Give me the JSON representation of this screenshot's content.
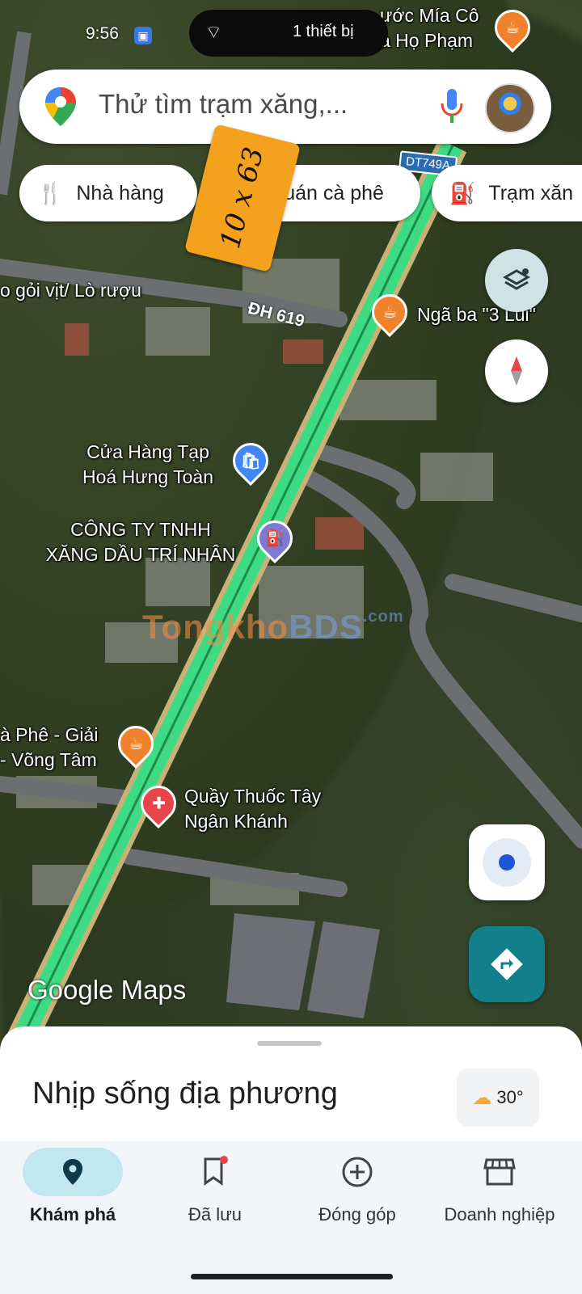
{
  "status_bar": {
    "time": "9:56",
    "island_text": "1 thiết bị"
  },
  "search": {
    "placeholder": "Thử tìm trạm xăng,..."
  },
  "chips": [
    {
      "label": "Nhà hàng",
      "icon": "fork-knife-icon"
    },
    {
      "label": "quán cà phê",
      "icon": "coffee-icon"
    },
    {
      "label": "Trạm xăn",
      "icon": "gas-pump-icon"
    }
  ],
  "sticker": {
    "text": "10 x 63"
  },
  "map": {
    "route_shield": "DT749A",
    "road_label": "ĐH 619",
    "places": {
      "top_partial": {
        "line1": "ước Mía Cô",
        "line2": "a Họ Phạm"
      },
      "lo_ruou": "o gỏi vịt/ Lò rượu",
      "nga_ba": "Ngã ba \"3 Lũi\"",
      "cua_hang": {
        "line1": "Cửa Hàng Tạp",
        "line2": "Hoá Hưng Toàn"
      },
      "cong_ty": {
        "line1": "CÔNG TY TNHH",
        "line2": "XĂNG DẦU TRÍ NHÂN"
      },
      "ca_phe": {
        "line1": "à Phê - Giải",
        "line2": "- Võng Tâm"
      },
      "quay_thuoc": {
        "line1": "Quầy Thuốc Tây",
        "line2": "Ngân Khánh"
      }
    },
    "watermark": {
      "part1": "Tongkho",
      "part2": "BDS",
      "suffix": ".com"
    },
    "google_logo": "Google Maps"
  },
  "sheet": {
    "title": "Nhịp sống địa phương",
    "weather": "30°"
  },
  "nav": [
    {
      "label": "Khám phá",
      "icon": "explore-pin-icon",
      "active": true
    },
    {
      "label": "Đã lưu",
      "icon": "bookmark-icon",
      "active": false
    },
    {
      "label": "Đóng góp",
      "icon": "add-circle-icon",
      "active": false
    },
    {
      "label": "Doanh nghiệp",
      "icon": "storefront-icon",
      "active": false
    }
  ],
  "colors": {
    "route": "#3ddc84",
    "cafe_pin": "#f0822b",
    "shop_pin": "#4285f4",
    "gas_pin": "#7b7bd6",
    "pharmacy_pin": "#e8454b",
    "directions_fab": "#137f8a",
    "nav_active_bg": "#c2e7ef"
  }
}
